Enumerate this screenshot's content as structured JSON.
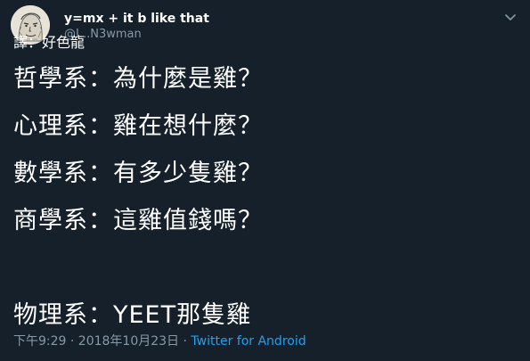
{
  "tweet": {
    "display_name": "y=mx + it b like that",
    "handle": "@I...N3wman",
    "translator_note": "譯：好色龍",
    "lines": [
      "哲學系：為什麼是雞？",
      "心理系：雞在想什麼？",
      "數學系：有多少隻雞？",
      "商學系：這雞值錢嗎？",
      "",
      "物理系：YEET那隻雞"
    ],
    "timestamp": "下午9:29 · 2018年10月23日 · ",
    "source": "Twitter for Android"
  },
  "icons": {
    "avatar": "avatar-sketch-face",
    "menu": "chevron-down-icon"
  },
  "colors": {
    "background": "#15202b",
    "text": "#ffffff",
    "muted": "#8899a6",
    "link": "#1da1f2"
  }
}
